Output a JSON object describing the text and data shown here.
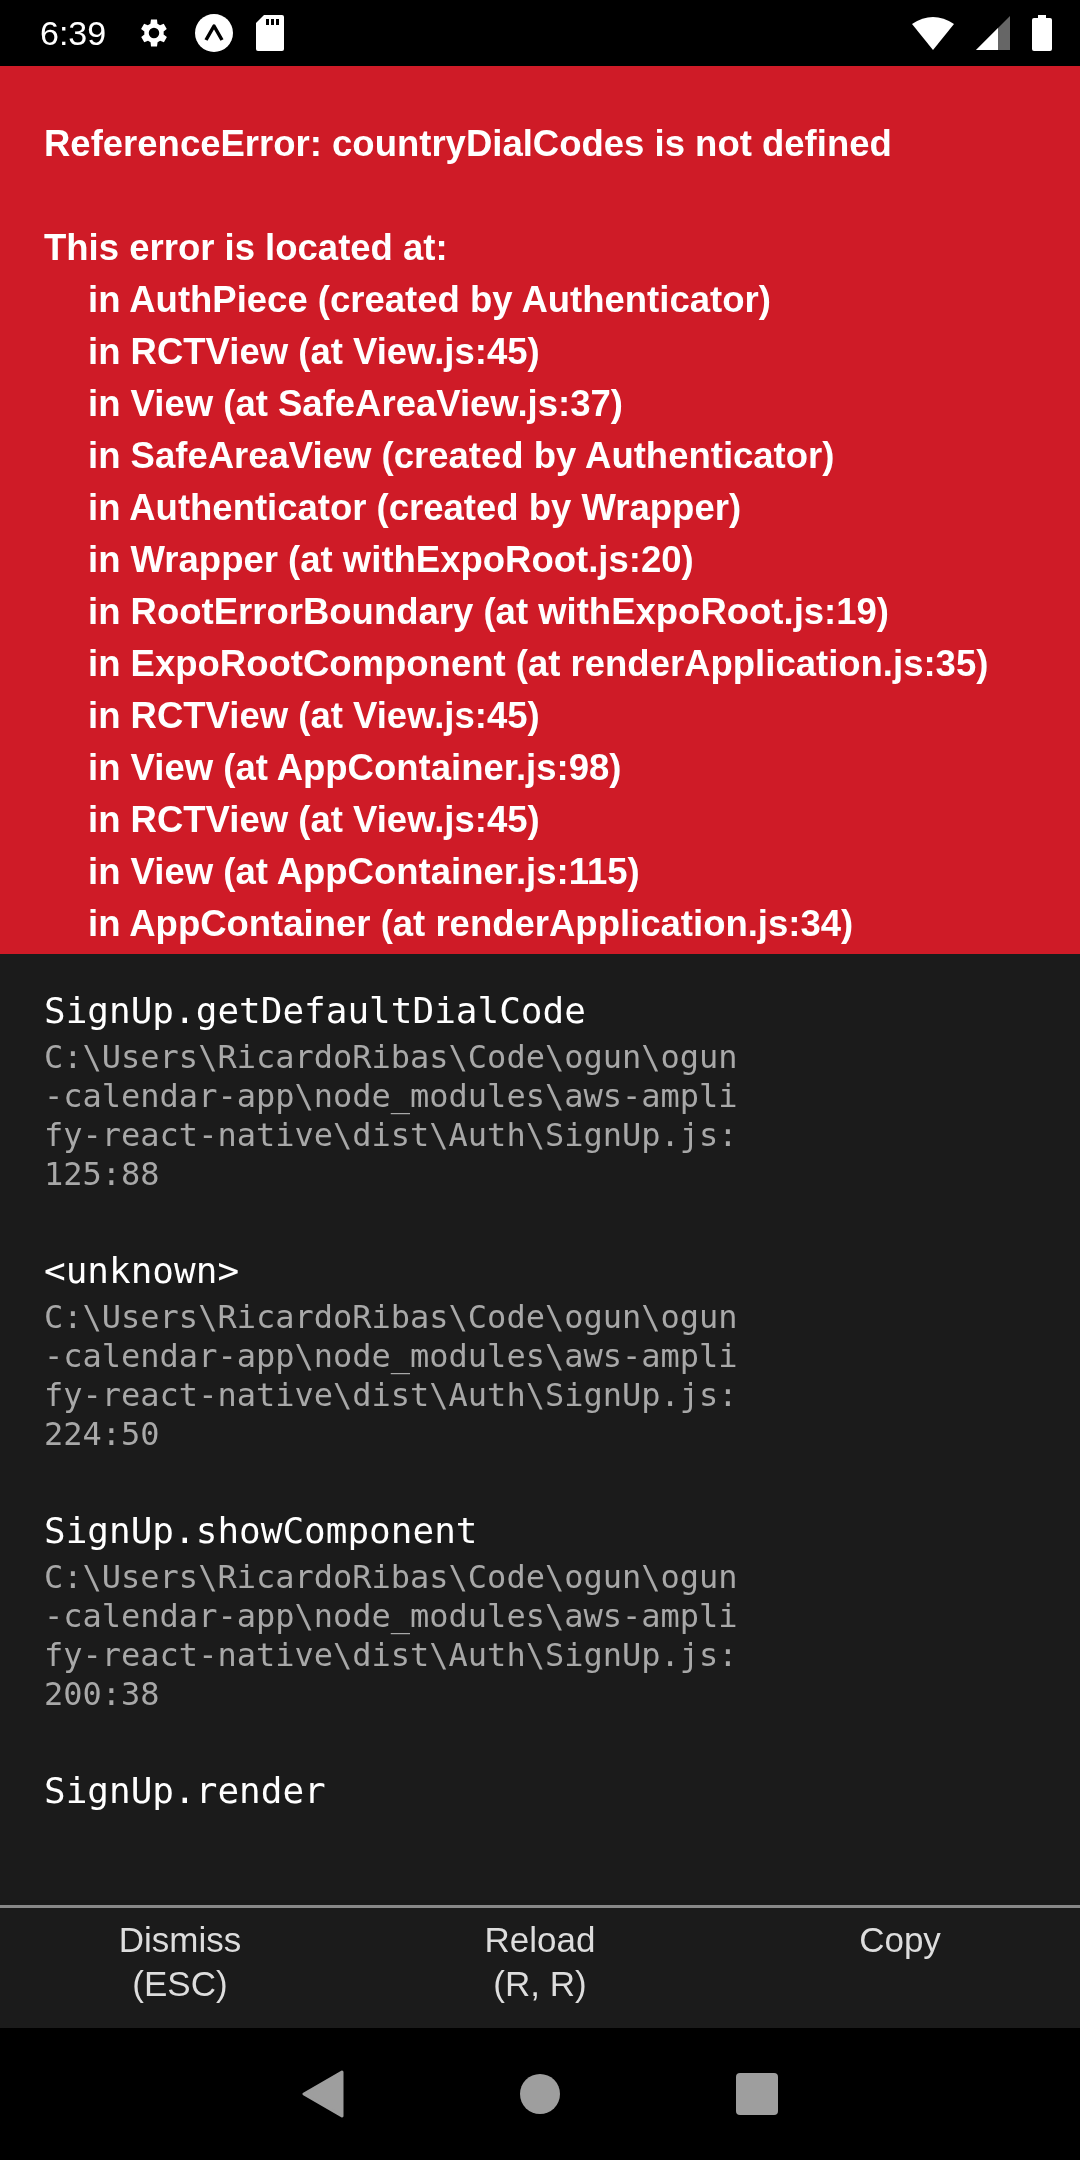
{
  "status_bar": {
    "time": "6:39"
  },
  "error": {
    "message": "ReferenceError: countryDialCodes is not defined",
    "location_heading": "This error is located at:",
    "component_stack": [
      "in AuthPiece (created by Authenticator)",
      "in RCTView (at View.js:45)",
      "in View (at SafeAreaView.js:37)",
      "in SafeAreaView (created by Authenticator)",
      "in Authenticator (created by Wrapper)",
      "in Wrapper (at withExpoRoot.js:20)",
      "in RootErrorBoundary (at withExpoRoot.js:19)",
      "in ExpoRootComponent (at renderApplication.js:35)",
      "in RCTView (at View.js:45)",
      "in View (at AppContainer.js:98)",
      "in RCTView (at View.js:45)",
      "in View (at AppContainer.js:115)",
      "in AppContainer (at renderApplication.js:34)"
    ]
  },
  "stack_frames": [
    {
      "method": "SignUp.getDefaultDialCode",
      "location": "C:\\Users\\RicardoRibas\\Code\\ogun\\ogun-calendar-app\\node_modules\\aws-amplify-react-native\\dist\\Auth\\SignUp.js:125:88"
    },
    {
      "method": "<unknown>",
      "location": "C:\\Users\\RicardoRibas\\Code\\ogun\\ogun-calendar-app\\node_modules\\aws-amplify-react-native\\dist\\Auth\\SignUp.js:224:50"
    },
    {
      "method": "SignUp.showComponent",
      "location": "C:\\Users\\RicardoRibas\\Code\\ogun\\ogun-calendar-app\\node_modules\\aws-amplify-react-native\\dist\\Auth\\SignUp.js:200:38"
    },
    {
      "method": "SignUp.render"
    }
  ],
  "buttons": [
    {
      "label": "Dismiss",
      "shortcut": "(ESC)"
    },
    {
      "label": "Reload",
      "shortcut": "(R, R)"
    },
    {
      "label": "Copy"
    }
  ]
}
